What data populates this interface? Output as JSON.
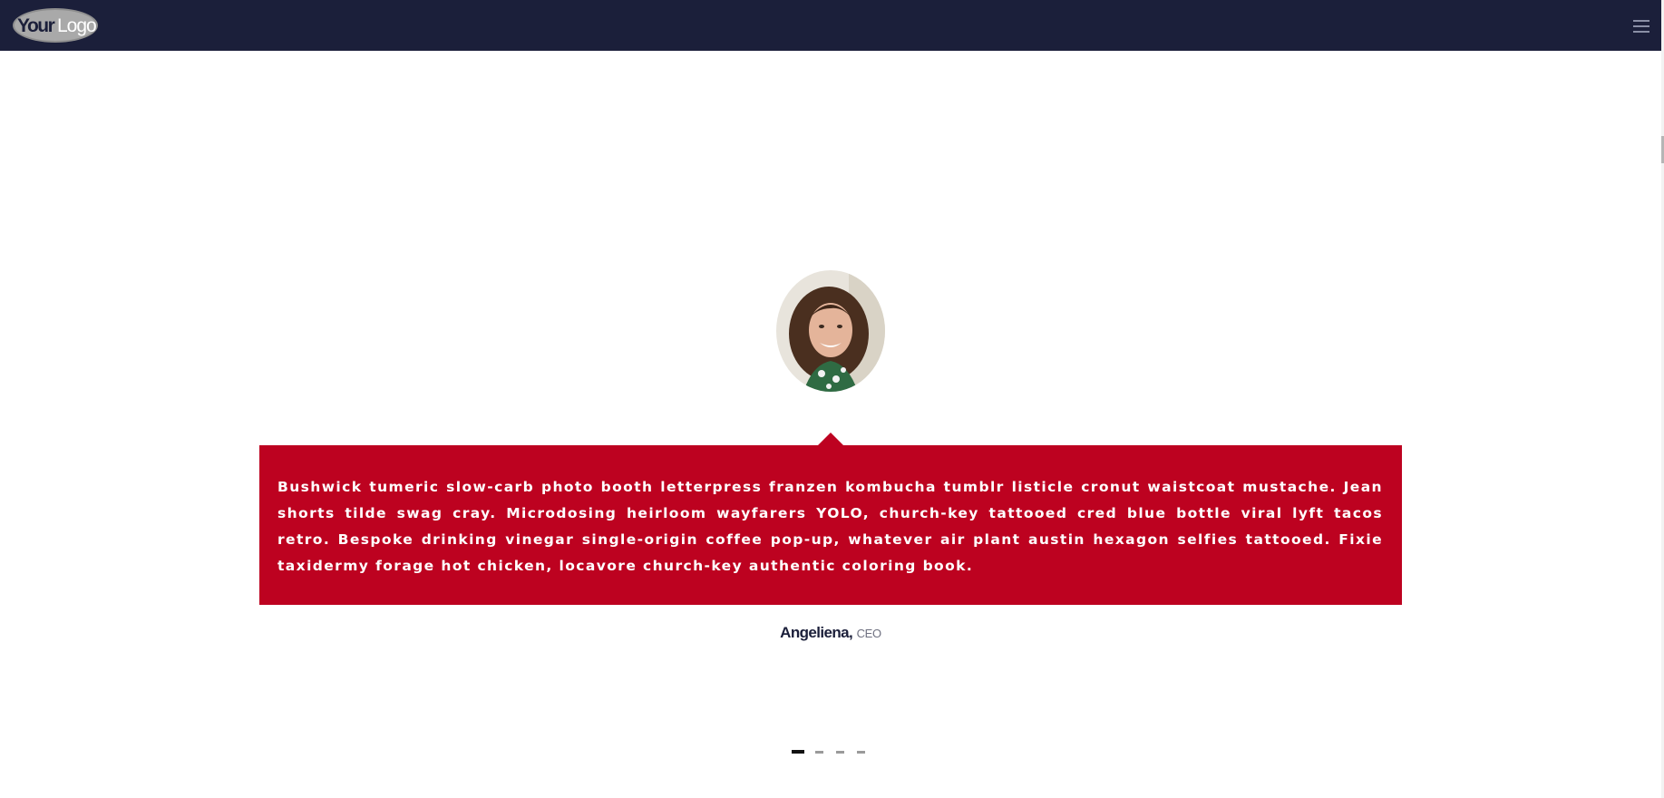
{
  "header": {
    "logo_text": "YourLogo",
    "menu_icon": "hamburger-menu-icon",
    "background": "#1b1f3a"
  },
  "testimonial": {
    "quote": "Bushwick tumeric slow-carb photo booth letterpress franzen kombucha tumblr listicle cronut waistcoat mustache. Jean shorts tilde swag cray. Microdosing heirloom wayfarers YOLO, church-key tattooed cred blue bottle viral lyft tacos retro. Bespoke drinking vinegar single-origin coffee pop-up, whatever air plant austin hexagon selfies tattooed. Fixie taxidermy forage hot chicken, locavore church-key authentic coloring book.",
    "author_name": "Angeliena,",
    "author_role": "CEO",
    "accent_color": "#bd0220"
  },
  "carousel": {
    "slide_count": 4,
    "active_index": 0
  }
}
